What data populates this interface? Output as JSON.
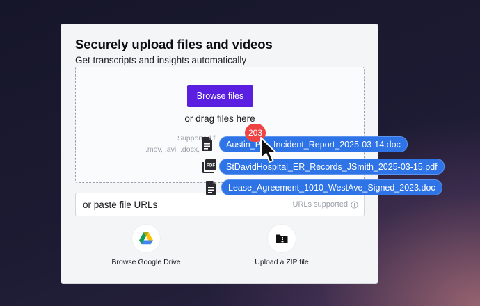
{
  "card": {
    "title": "Securely upload files and videos",
    "subtitle": "Get transcripts and insights automatically"
  },
  "dropzone": {
    "browse_label": "Browse files",
    "drag_text": "or drag files here",
    "supported_line1": "Supported f",
    "supported_line2": ".mov, .avi, .docx, "
  },
  "url": {
    "placeholder": "or paste file URLs",
    "hint": "URLs supported"
  },
  "sources": [
    {
      "label": "Browse Google Drive",
      "icon": "google-drive-icon"
    },
    {
      "label": "Upload a ZIP file",
      "icon": "zip-folder-icon"
    }
  ],
  "drag": {
    "count": "203",
    "files": [
      {
        "name": "Austin_P",
        "name_rest": "Incident_Report_2025-03-14.doc",
        "icon": "document-icon"
      },
      {
        "name": "StDavidHospital_ER_Records_JSmith_2025-03-15.pdf",
        "icon": "pdf-icon"
      },
      {
        "name": "Lease_Agreement_1010_WestAve_Signed_2023.doc",
        "icon": "document-icon"
      }
    ]
  },
  "colors": {
    "accent": "#5a1fe0",
    "pill": "#2e74e6",
    "badge": "#ef4444"
  }
}
